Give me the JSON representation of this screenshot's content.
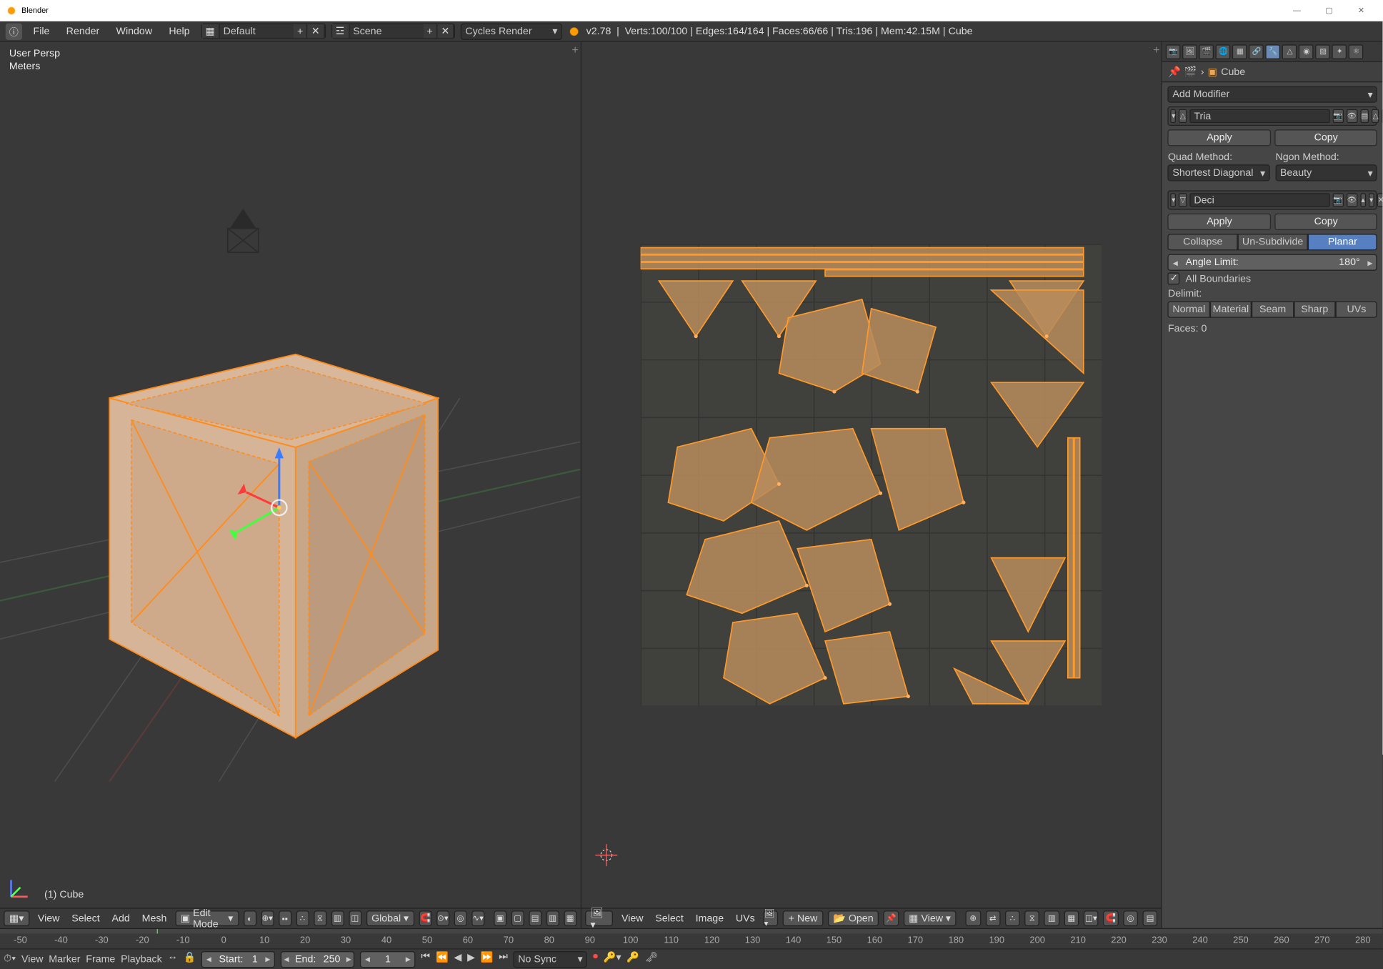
{
  "window": {
    "title": "Blender",
    "min": "—",
    "max": "▢",
    "close": "✕"
  },
  "header": {
    "menus": [
      "File",
      "Render",
      "Window",
      "Help"
    ],
    "layout_name": "Default",
    "scene_name": "Scene",
    "engine": "Cycles Render",
    "version": "v2.78",
    "stats": "Verts:100/100 | Edges:164/164 | Faces:66/66 | Tris:196 | Mem:42.15M | Cube"
  },
  "view3d": {
    "persp": "User Persp",
    "units": "Meters",
    "object_label": "(1) Cube",
    "header_menus": [
      "View",
      "Select",
      "Add",
      "Mesh"
    ],
    "mode": "Edit Mode",
    "orientation": "Global"
  },
  "uv": {
    "header_menus": [
      "View",
      "Select",
      "Image",
      "UVs"
    ],
    "new_btn": "New",
    "open_btn": "Open",
    "view_btn": "View"
  },
  "timeline": {
    "menus": [
      "View",
      "Marker",
      "Frame",
      "Playback"
    ],
    "start_label": "Start:",
    "start_value": "1",
    "end_label": "End:",
    "end_value": "250",
    "current": "1",
    "sync": "No Sync",
    "ruler": [
      "-50",
      "-40",
      "-30",
      "-20",
      "-10",
      "0",
      "10",
      "20",
      "30",
      "40",
      "50",
      "60",
      "70",
      "80",
      "90",
      "100",
      "110",
      "120",
      "130",
      "140",
      "150",
      "160",
      "170",
      "180",
      "190",
      "200",
      "210",
      "220",
      "230",
      "240",
      "250",
      "260",
      "270",
      "280"
    ]
  },
  "props": {
    "breadcrumb_obj": "Cube",
    "add_modifier": "Add Modifier",
    "mod_tri": {
      "name": "Tria",
      "apply": "Apply",
      "copy": "Copy",
      "quad_method_label": "Quad Method:",
      "quad_method": "Shortest Diagonal",
      "ngon_method_label": "Ngon Method:",
      "ngon_method": "Beauty"
    },
    "mod_dec": {
      "name": "Deci",
      "apply": "Apply",
      "copy": "Copy",
      "tabs": [
        "Collapse",
        "Un-Subdivide",
        "Planar"
      ],
      "angle_label": "Angle Limit:",
      "angle_value": "180°",
      "all_boundaries": "All Boundaries",
      "delimit": "Delimit:",
      "delimit_tabs": [
        "Normal",
        "Material",
        "Seam",
        "Sharp",
        "UVs"
      ],
      "faces": "Faces: 0"
    }
  }
}
